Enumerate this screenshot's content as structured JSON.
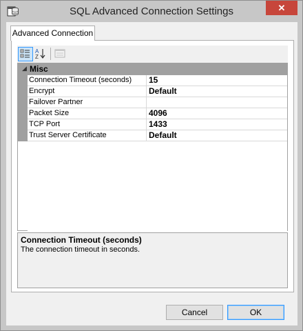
{
  "window": {
    "title": "SQL Advanced Connection Settings",
    "close_glyph": "✕",
    "icon": "database-window-icon"
  },
  "tabs": [
    {
      "label": "Advanced Connection",
      "selected": true
    }
  ],
  "toolbar": {
    "buttons": [
      {
        "icon": "categorized-icon",
        "active": true
      },
      {
        "icon": "alphabetical-sort-icon",
        "active": false
      },
      {
        "icon": "property-pages-icon",
        "active": false,
        "disabled": true
      }
    ]
  },
  "property_grid": {
    "category": {
      "label": "Misc",
      "expanded": true,
      "toggle_glyph": "◢"
    },
    "properties": [
      {
        "name": "Connection Timeout (seconds)",
        "value": "15"
      },
      {
        "name": "Encrypt",
        "value": "Default"
      },
      {
        "name": "Failover Partner",
        "value": ""
      },
      {
        "name": "Packet Size",
        "value": "4096"
      },
      {
        "name": "TCP Port",
        "value": "1433"
      },
      {
        "name": "Trust Server Certificate",
        "value": "Default"
      }
    ]
  },
  "help": {
    "title": "Connection Timeout (seconds)",
    "description": "The connection timeout in seconds."
  },
  "buttons": {
    "cancel_label": "Cancel",
    "ok_label": "OK"
  },
  "colors": {
    "titlebar": "#c7c7c7",
    "close_button": "#c7463b",
    "grid_category": "#a0a0a0",
    "active_toolbar": "#cce4f7"
  }
}
